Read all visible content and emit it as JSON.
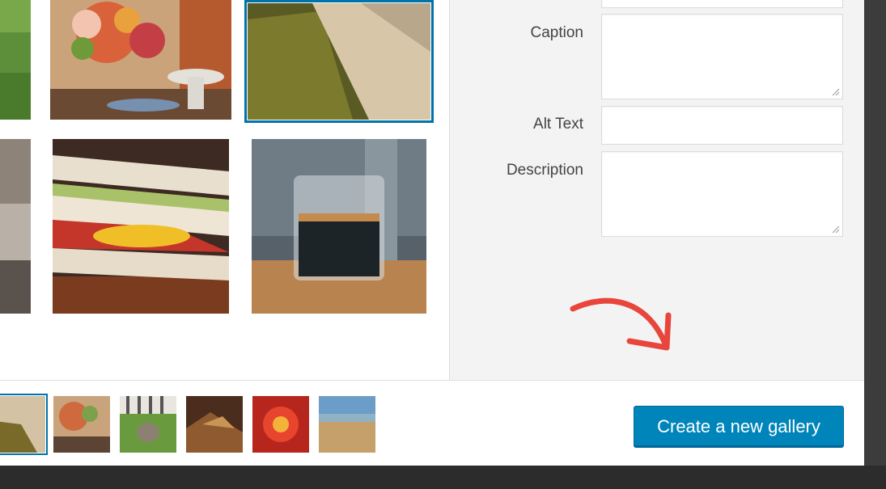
{
  "sidebar": {
    "caption_label": "Caption",
    "caption_value": "",
    "alt_text_label": "Alt Text",
    "alt_text_value": "",
    "description_label": "Description",
    "description_value": ""
  },
  "footer": {
    "create_gallery_label": "Create a new gallery"
  },
  "colors": {
    "accent": "#0085ba",
    "selection_border": "#0073aa",
    "annotation_arrow": "#e8453c"
  }
}
